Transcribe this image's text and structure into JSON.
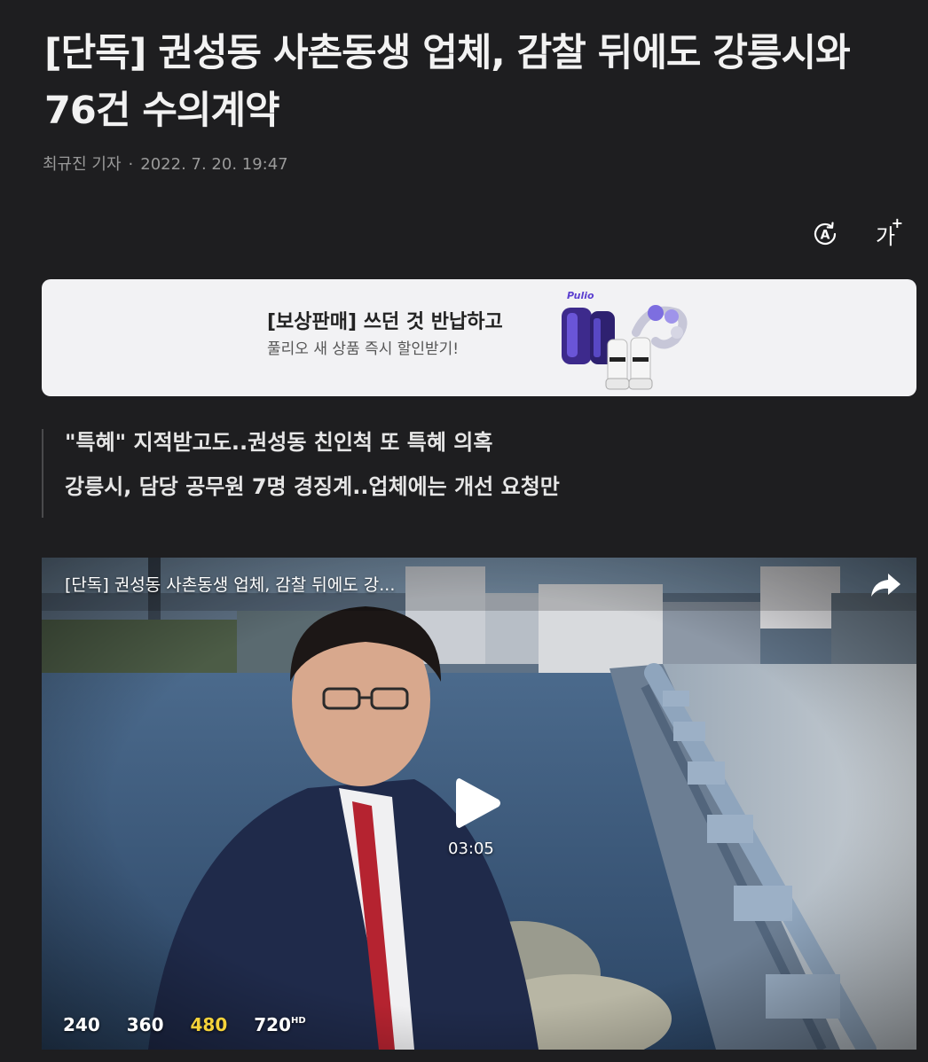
{
  "article": {
    "headline": "[단독] 권성동 사촌동생 업체, 감찰 뒤에도 강릉시와 76건 수의계약",
    "reporter": "최규진 기자",
    "byline_separator": "·",
    "date": "2022. 7. 20. 19:47"
  },
  "toolbar": {
    "summary_icon": "auto-summary-icon",
    "font_size_label": "가",
    "font_size_plus": "+"
  },
  "ad": {
    "title": "[보상판매] 쓰던 것 반납하고",
    "subtitle": "풀리오 새 상품 즉시 할인받기!",
    "brand": "Pulio"
  },
  "summary": {
    "lines": [
      "\"특혜\" 지적받고도..권성동 친인척 또 특혜 의혹",
      "강릉시, 담당 공무원 7명 경징계..업체에는 개선 요청만"
    ]
  },
  "video": {
    "title": "[단독] 권성동 사촌동생 업체, 감찰 뒤에도 강...",
    "duration": "03:05",
    "qualities": [
      "240",
      "360",
      "480",
      "720"
    ],
    "hd_badge": "HD",
    "selected_quality": "480"
  },
  "colors": {
    "background": "#1e1e20",
    "selected_quality": "#f4d23a",
    "ad_background": "#f2f2f4"
  }
}
